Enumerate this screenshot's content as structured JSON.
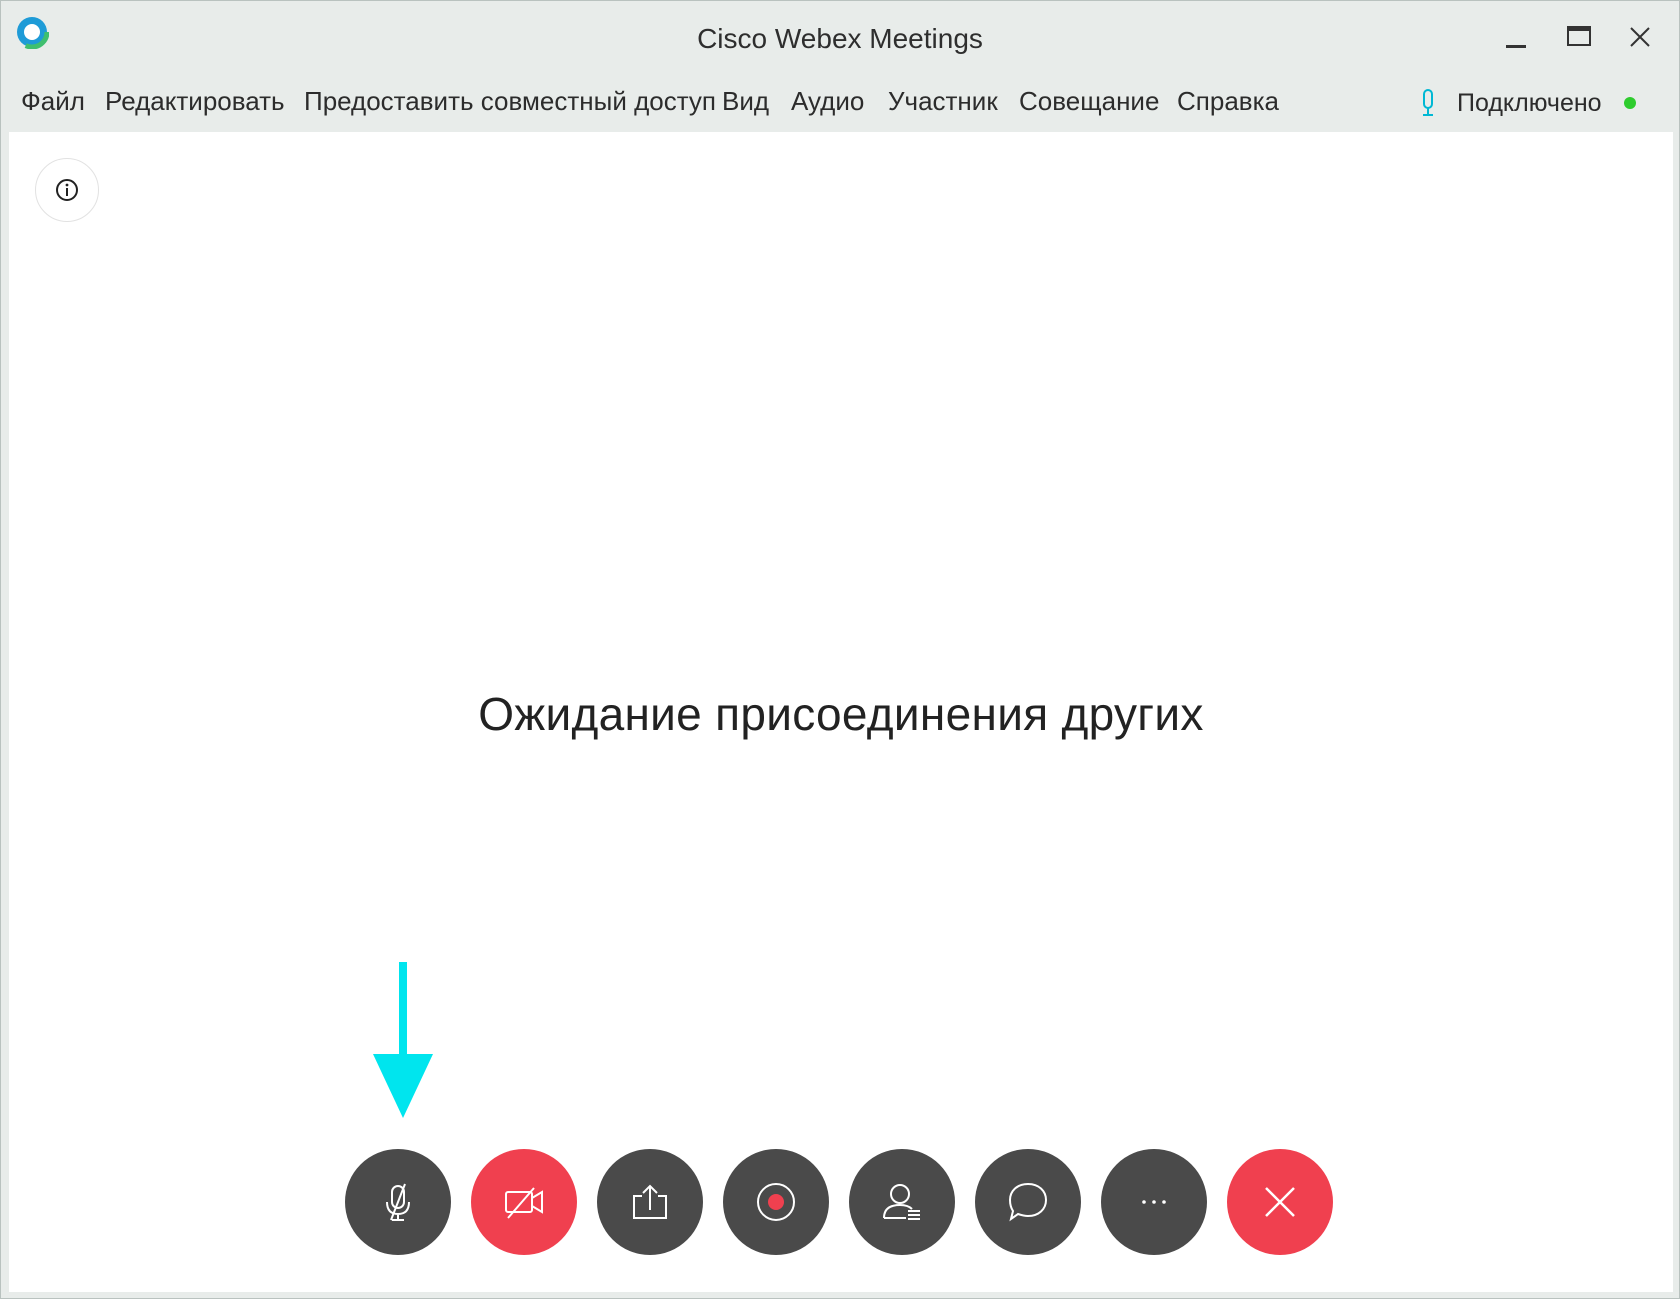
{
  "window": {
    "title": "Cisco Webex Meetings"
  },
  "menu": [
    {
      "label": "Файл"
    },
    {
      "label": "Редактировать"
    },
    {
      "label": "Предоставить совместный доступ"
    },
    {
      "label": "Вид"
    },
    {
      "label": "Аудио"
    },
    {
      "label": "Участник"
    },
    {
      "label": "Совещание"
    },
    {
      "label": "Справка"
    }
  ],
  "status": {
    "label": "Подключено",
    "icon": "microphone-icon",
    "indicator_color": "#2ecc2e"
  },
  "main": {
    "waiting_text": "Ожидание присоединения других"
  },
  "controls": [
    {
      "icon": "mic-muted-icon"
    },
    {
      "icon": "video-off-icon",
      "color": "#f0404f"
    },
    {
      "icon": "share-icon"
    },
    {
      "icon": "record-icon"
    },
    {
      "icon": "participants-icon"
    },
    {
      "icon": "chat-icon"
    },
    {
      "icon": "more-icon"
    },
    {
      "icon": "end-meeting-icon",
      "color": "#f0404f"
    }
  ],
  "colors": {
    "control_dark": "#4a4a4a",
    "control_red": "#f0404f",
    "annotation_arrow": "#00e5ee"
  }
}
